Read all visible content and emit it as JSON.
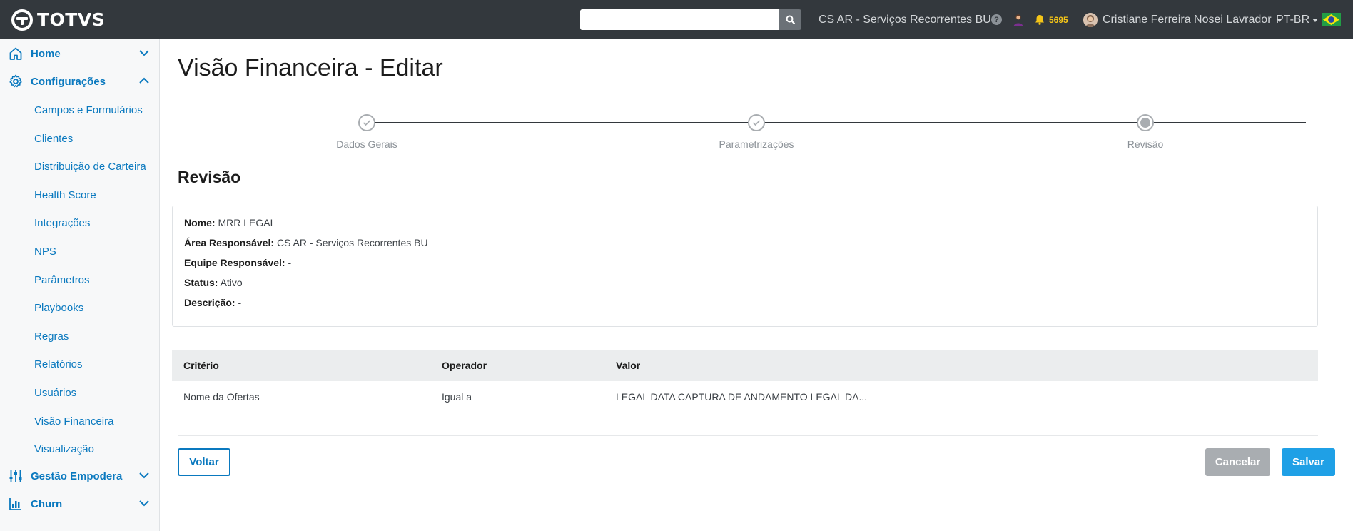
{
  "app": {
    "logo_text": "TOTVS"
  },
  "topbar": {
    "search_placeholder": "",
    "area_label": "CS AR - Serviços Recorrentes BU",
    "help_label": "?",
    "notifications_count": "5695",
    "user_name": "Cristiane Ferreira Nosei Lavrador",
    "language": "PT-BR"
  },
  "sidebar": {
    "home": "Home",
    "config": "Configurações",
    "config_items": [
      "Campos e Formulários",
      "Clientes",
      "Distribuição de Carteira",
      "Health Score",
      "Integrações",
      "NPS",
      "Parâmetros",
      "Playbooks",
      "Regras",
      "Relatórios",
      "Usuários",
      "Visão Financeira",
      "Visualização"
    ],
    "gestao": "Gestão Empodera",
    "churn": "Churn"
  },
  "page": {
    "title": "Visão Financeira - Editar",
    "steps": [
      "Dados Gerais",
      "Parametrizações",
      "Revisão"
    ],
    "section_title": "Revisão"
  },
  "info": {
    "nome_label": "Nome:",
    "nome_value": "MRR LEGAL",
    "area_label": "Área Responsável:",
    "area_value": "CS AR - Serviços Recorrentes BU",
    "equipe_label": "Equipe Responsável:",
    "equipe_value": "-",
    "status_label": "Status:",
    "status_value": "Ativo",
    "descricao_label": "Descrição:",
    "descricao_value": "-"
  },
  "table": {
    "headers": [
      "Critério",
      "Operador",
      "Valor"
    ],
    "rows": [
      [
        "Nome da Ofertas",
        "Igual a",
        "LEGAL DATA CAPTURA DE ANDAMENTO LEGAL DA..."
      ]
    ]
  },
  "buttons": {
    "back": "Voltar",
    "cancel": "Cancelar",
    "save": "Salvar"
  },
  "colors": {
    "topbar": "#33383d",
    "accent": "#0a79bf",
    "save": "#1fa0e6",
    "cancel": "#a9adb1",
    "notif": "#f5c518"
  }
}
